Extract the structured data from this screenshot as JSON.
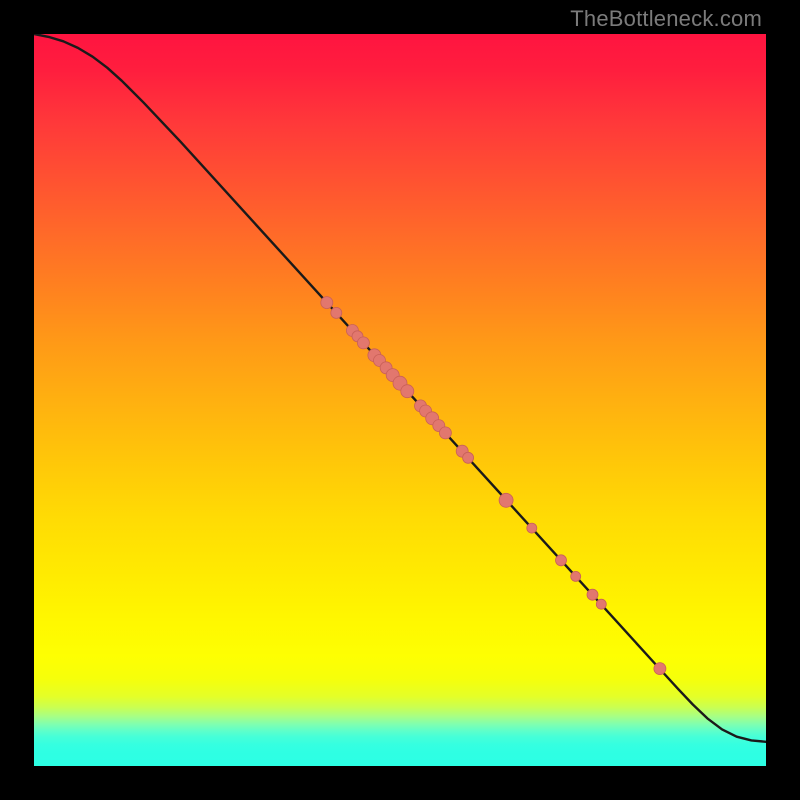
{
  "watermark": "TheBottleneck.com",
  "colors": {
    "page_bg": "#000000",
    "marker_fill": "#e2776e",
    "marker_stroke": "#c96058",
    "curve": "#1a1a1a",
    "watermark": "#7b7b7b"
  },
  "chart_data": {
    "type": "line",
    "title": "",
    "xlabel": "",
    "ylabel": "",
    "x_range": [
      0,
      100
    ],
    "y_range": [
      0,
      100
    ],
    "grid": false,
    "note": "No axes or labels rendered in image; values are normalized estimates read from pixel positions.",
    "curve": {
      "x": [
        0,
        2,
        4,
        6,
        8,
        10,
        12,
        15,
        20,
        30,
        40,
        50,
        60,
        70,
        80,
        85,
        88,
        90,
        92,
        94,
        96,
        98,
        100
      ],
      "y": [
        100,
        99.6,
        99.0,
        98.1,
        96.9,
        95.4,
        93.6,
        90.6,
        85.3,
        74.3,
        63.3,
        52.3,
        41.3,
        30.3,
        19.3,
        13.8,
        10.5,
        8.4,
        6.5,
        5.0,
        4.0,
        3.5,
        3.3
      ]
    },
    "series": [
      {
        "name": "points",
        "type": "scatter",
        "x": [
          40.0,
          41.3,
          43.5,
          44.2,
          45.0,
          46.5,
          47.2,
          48.1,
          49.0,
          50.0,
          51.0,
          52.8,
          53.5,
          54.4,
          55.3,
          56.2,
          58.5,
          59.3,
          64.5,
          68.0,
          72.0,
          74.0,
          76.3,
          77.5,
          85.5
        ],
        "y": [
          63.3,
          61.9,
          59.5,
          58.7,
          57.8,
          56.1,
          55.4,
          54.4,
          53.4,
          52.3,
          51.2,
          49.2,
          48.5,
          47.5,
          46.5,
          45.5,
          43.0,
          42.1,
          36.3,
          32.5,
          28.1,
          25.9,
          23.4,
          22.1,
          13.3
        ],
        "r": [
          6,
          5.5,
          6,
          5.5,
          6,
          6.5,
          6,
          6,
          6.5,
          7,
          6.5,
          6,
          6,
          6.5,
          6,
          6,
          6,
          5.5,
          7,
          5,
          5.5,
          5,
          5.5,
          5,
          6
        ]
      }
    ]
  }
}
